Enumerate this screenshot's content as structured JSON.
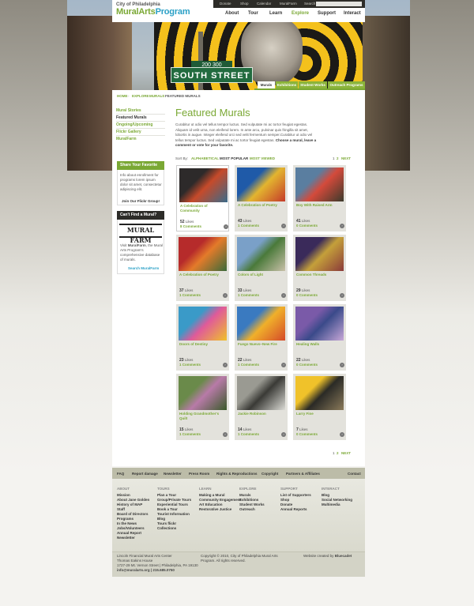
{
  "brand": {
    "line1": "City of Philadelphia",
    "name_a": "Mural",
    "name_b": "Arts",
    "name_c": "Program",
    "accent": "#7aa834",
    "blue": "#2aa0c6"
  },
  "util": {
    "items": [
      "Donate",
      "Shop",
      "Calendar",
      "MuralFarm",
      "Search"
    ]
  },
  "mainnav": {
    "items": [
      "About",
      "Tour",
      "Learn",
      "Explore",
      "Support",
      "Interact"
    ],
    "active": "Explore"
  },
  "hero": {
    "sign_small": "200 300",
    "sign_big": "SOUTH STREET"
  },
  "subtabs": [
    "Murals",
    "Exhibitions",
    "Student Works",
    "Outreach Programs"
  ],
  "breadcrumb": [
    "HOME",
    "EXPLORE",
    "MURALS",
    "FEATURED MURALS"
  ],
  "sidebar": {
    "nav": [
      "Mural Stories",
      "Featured Murals",
      "Ongoing/Upcoming",
      "Flickr Gallery",
      "MuralFarm"
    ],
    "share": {
      "title_a": "Share",
      "title_b": "Your Favorite Mural",
      "text": "Info about enrollment for programs lorem ipsum dolor sit amet, consectetur adipiscing elit.",
      "link": "Join Our Flickr Group!"
    },
    "muralfarm": {
      "title_a": "Can't",
      "title_b": "Find a Mural?",
      "logo": "MURAL FARM",
      "text_a": "Visit",
      "text_b": "MuralFarm",
      "text_c": ", the Mural Arts Program's comprehensive database of murals.",
      "link": "Search MuralFarm"
    }
  },
  "main": {
    "title": "Featured Murals",
    "intro": "Curabitur ut odio vel tellus tempor luctus. Sed vulputate mi ac tortor feugiat egestas. Aliquam id velit urna, non eleifend lorem. In ante arcu, pulvinar quis fringilla sit amet, lobortis in augue. Integer eleifend orci sed velit fermentum semper.Curabitur ut odio vel tellus tempor luctus. Sed vulputate mi ac tortor feugiat egestas.",
    "intro_bold": "Choose a mural, leave a comment or vote for your favorite.",
    "sort_label": "Sort By:",
    "sort_options": [
      "ALPHABETICAL",
      "MOST POPULAR",
      "MOST VIEWED"
    ],
    "pager": {
      "p1": "1",
      "p2": "2",
      "next": "NEXT"
    },
    "likes_word": "Likes",
    "comments_word": "Comments",
    "murals": [
      {
        "title": "A Celebration of Community",
        "likes": "52",
        "comments": "8"
      },
      {
        "title": "A Celebration of Poetry",
        "likes": "43",
        "comments": "1"
      },
      {
        "title": "Boy With Raised Arm",
        "likes": "41",
        "comments": "0"
      },
      {
        "title": "A Celebration of Poetry",
        "likes": "37",
        "comments": "1"
      },
      {
        "title": "Colors of Light",
        "likes": "33",
        "comments": "1"
      },
      {
        "title": "Common Threads",
        "likes": "29",
        "comments": "0"
      },
      {
        "title": "Doors of Destiny",
        "likes": "23",
        "comments": "1"
      },
      {
        "title": "Fuego Nuevo–New Fire",
        "likes": "22",
        "comments": "1"
      },
      {
        "title": "Healing Walls",
        "likes": "22",
        "comments": "0"
      },
      {
        "title": "Holding Grandmother's Quilt",
        "likes": "15",
        "comments": "1"
      },
      {
        "title": "Jackie Robinson",
        "likes": "14",
        "comments": "1"
      },
      {
        "title": "Larry Fine",
        "likes": "7",
        "comments": "0"
      }
    ]
  },
  "footer": {
    "links": [
      "FAQ",
      "Report damage",
      "Newsletter",
      "Press Room",
      "Rights & Reproductions",
      "Copyright",
      "Partners & Affiliates",
      "Contact"
    ],
    "cols": [
      {
        "head": "ABOUT",
        "items": [
          "Mission",
          "About Jane Golden",
          "History of MAP",
          "Staff",
          "Board of Directors",
          "Programs",
          "In the News",
          "Jobs/Volunteers",
          "Annual Report",
          "Newsletter"
        ]
      },
      {
        "head": "TOURS",
        "items": [
          "Plan a Tour",
          "Group/Private Tours",
          "Experiential Tours",
          "Book a Tour",
          "Tourist Information",
          "Blog",
          "Tours flickr",
          "Collections"
        ]
      },
      {
        "head": "LEARN",
        "items": [
          "Making a Mural",
          "Community Engagement",
          "Art Education",
          "Restorative Justice"
        ]
      },
      {
        "head": "EXPLORE",
        "items": [
          "Murals",
          "Exhibitions",
          "Student Works",
          "Outreach"
        ]
      },
      {
        "head": "SUPPORT",
        "items": [
          "List of Supporters",
          "Shop",
          "Donate",
          "Annual Reports"
        ]
      },
      {
        "head": "INTERACT",
        "items": [
          "Blog",
          "Social Networking",
          "Multimedia"
        ]
      }
    ],
    "address": [
      "Lincoln Financial Mural Arts Center",
      "Thomas Eakins House",
      "1727-29 Mt. Vernon Street | Philadelphia, PA 19130",
      "info@muralarts.org | 215.685.0750"
    ],
    "copyright": [
      "Copyright © 2010, City of Philadelphia Mural Arts",
      "Program. All rights reserved."
    ],
    "credit_a": "Website created by",
    "credit_b": "Bluecadet"
  }
}
